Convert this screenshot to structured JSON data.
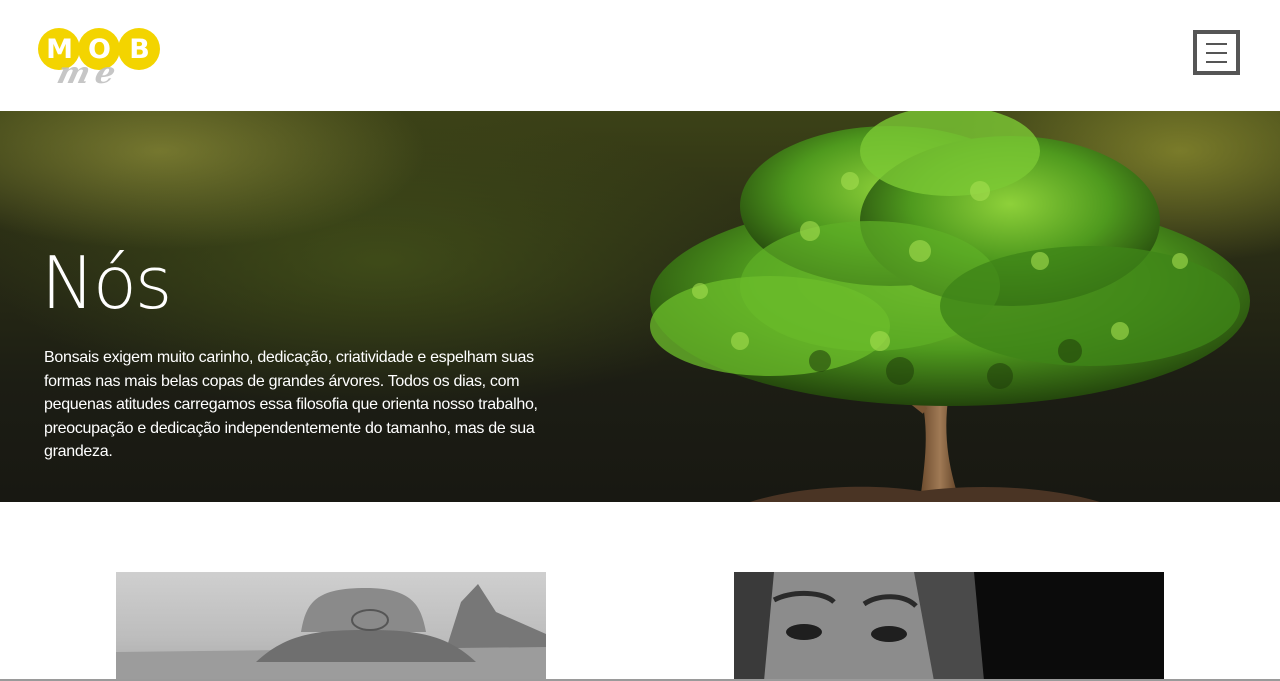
{
  "brand": {
    "logo_letters": [
      "M",
      "O",
      "B"
    ],
    "logo_sub": "me",
    "accent_color": "#f3d400"
  },
  "header": {
    "menu_icon": "hamburger-icon"
  },
  "hero": {
    "title": "Nós",
    "text": "Bonsais exigem muito carinho, dedicação, criatividade e espelham suas formas nas mais belas copas de grandes árvores. Todos os dias, com pequenas atitudes carregamos essa filosofia que orienta nosso trabalho, preocupação e dedicação independentemente do tamanho, mas de sua grandeza."
  },
  "team": {
    "photos": [
      "grayscale-hat-portrait",
      "grayscale-woman-portrait"
    ]
  }
}
